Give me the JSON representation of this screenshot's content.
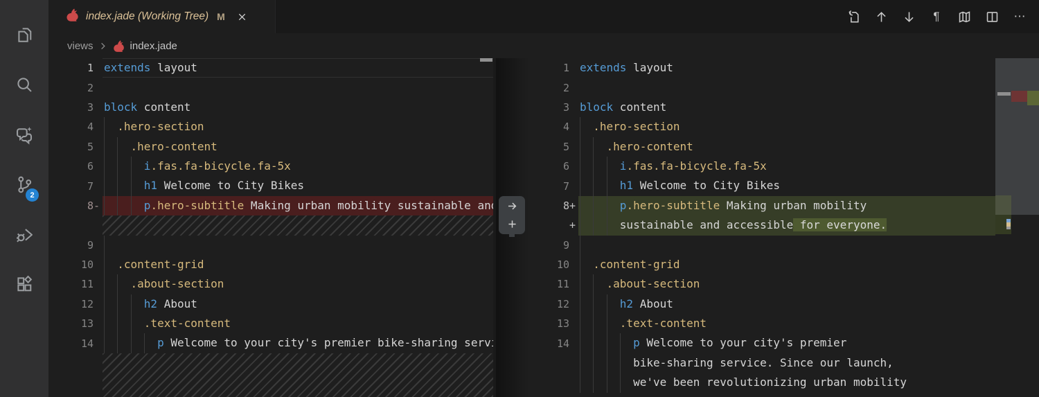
{
  "tab": {
    "title": "index.jade (Working Tree)",
    "status_badge": "M"
  },
  "breadcrumb": {
    "folder": "views",
    "file": "index.jade",
    "file_icon": "jade-rabbit-icon"
  },
  "toolbar": {
    "icons": [
      "revert-file",
      "previous-change",
      "next-change",
      "toggle-whitespace",
      "map",
      "split-editor",
      "more-actions"
    ],
    "pilcrow": "¶",
    "ellipsis": "⋯"
  },
  "activity_bar": {
    "items": [
      {
        "name": "explorer"
      },
      {
        "name": "search"
      },
      {
        "name": "copilot-chat"
      },
      {
        "name": "source-control",
        "badge": "2"
      },
      {
        "name": "run-and-debug"
      },
      {
        "name": "extensions"
      }
    ]
  },
  "colors": {
    "editor_bg": "#1e1e1e",
    "activity_bar_bg": "#303031",
    "badge_blue": "#2483d2",
    "removed_line_bg": "#4a1e1e",
    "added_line_bg": "#363d27",
    "inserted_char_bg": "#4e5a30",
    "keyword": "#569cd6",
    "class_literal": "#d7ba7d",
    "plain_text": "#d6d6d6",
    "line_number": "#858585",
    "modified_tab_label": "#dcc298"
  },
  "editors": {
    "left": {
      "side": "original",
      "rows": [
        {
          "n": "1",
          "kind": "current",
          "g": 0,
          "segs": [
            [
              "k",
              "extends"
            ],
            [
              "t",
              " layout"
            ]
          ]
        },
        {
          "n": "2",
          "kind": "blank",
          "g": 0,
          "segs": []
        },
        {
          "n": "3",
          "kind": "n",
          "g": 0,
          "segs": [
            [
              "k",
              "block"
            ],
            [
              "t",
              " content"
            ]
          ]
        },
        {
          "n": "4",
          "kind": "n",
          "g": 1,
          "segs": [
            [
              "t",
              "  "
            ],
            [
              "c",
              ".hero-section"
            ]
          ]
        },
        {
          "n": "5",
          "kind": "n",
          "g": 2,
          "segs": [
            [
              "t",
              "    "
            ],
            [
              "c",
              ".hero-content"
            ]
          ]
        },
        {
          "n": "6",
          "kind": "n",
          "g": 3,
          "segs": [
            [
              "t",
              "      "
            ],
            [
              "g",
              "i"
            ],
            [
              "c",
              ".fas.fa-bicycle.fa-5x"
            ]
          ]
        },
        {
          "n": "7",
          "kind": "n",
          "g": 3,
          "segs": [
            [
              "t",
              "      "
            ],
            [
              "g",
              "h1"
            ],
            [
              "t",
              " Welcome to City Bikes"
            ]
          ]
        },
        {
          "n": "8",
          "sign": "-",
          "kind": "removed",
          "g": 3,
          "segs": [
            [
              "t",
              "      "
            ],
            [
              "g",
              "p"
            ],
            [
              "c",
              ".hero-subtitle"
            ],
            [
              "t",
              " Making urban mobility sustainable and accessible for everyone."
            ]
          ]
        },
        {
          "kind": "hatch",
          "g": 0,
          "segs": []
        },
        {
          "n": "9",
          "kind": "blank",
          "g": 1,
          "segs": []
        },
        {
          "n": "10",
          "kind": "n",
          "g": 1,
          "segs": [
            [
              "t",
              "  "
            ],
            [
              "c",
              ".content-grid"
            ]
          ]
        },
        {
          "n": "11",
          "kind": "n",
          "g": 2,
          "segs": [
            [
              "t",
              "    "
            ],
            [
              "c",
              ".about-section"
            ]
          ]
        },
        {
          "n": "12",
          "kind": "n",
          "g": 3,
          "segs": [
            [
              "t",
              "      "
            ],
            [
              "g",
              "h2"
            ],
            [
              "t",
              " About"
            ]
          ]
        },
        {
          "n": "13",
          "kind": "n",
          "g": 3,
          "segs": [
            [
              "t",
              "      "
            ],
            [
              "c",
              ".text-content"
            ]
          ]
        },
        {
          "n": "14",
          "kind": "n",
          "g": 4,
          "segs": [
            [
              "t",
              "        "
            ],
            [
              "g",
              "p"
            ],
            [
              "t",
              " Welcome to your city's premier bike-sharing service. Since our launch, we've been revolutionizing urban mobility"
            ]
          ]
        },
        {
          "kind": "hatch",
          "tall": true,
          "g": 0,
          "segs": []
        }
      ]
    },
    "right": {
      "side": "modified",
      "rows": [
        {
          "n": "1",
          "kind": "n",
          "g": 0,
          "segs": [
            [
              "k",
              "extends"
            ],
            [
              "t",
              " layout"
            ]
          ]
        },
        {
          "n": "2",
          "kind": "blank",
          "g": 0,
          "segs": []
        },
        {
          "n": "3",
          "kind": "n",
          "g": 0,
          "segs": [
            [
              "k",
              "block"
            ],
            [
              "t",
              " content"
            ]
          ]
        },
        {
          "n": "4",
          "kind": "n",
          "g": 1,
          "segs": [
            [
              "t",
              "  "
            ],
            [
              "c",
              ".hero-section"
            ]
          ]
        },
        {
          "n": "5",
          "kind": "n",
          "g": 2,
          "segs": [
            [
              "t",
              "    "
            ],
            [
              "c",
              ".hero-content"
            ]
          ]
        },
        {
          "n": "6",
          "kind": "n",
          "g": 3,
          "segs": [
            [
              "t",
              "      "
            ],
            [
              "g",
              "i"
            ],
            [
              "c",
              ".fas.fa-bicycle.fa-5x"
            ]
          ]
        },
        {
          "n": "7",
          "kind": "n",
          "g": 3,
          "segs": [
            [
              "t",
              "      "
            ],
            [
              "g",
              "h1"
            ],
            [
              "t",
              " Welcome to City Bikes"
            ]
          ]
        },
        {
          "n": "8",
          "sign": "+",
          "kind": "added",
          "g": 3,
          "segs": [
            [
              "t",
              "      "
            ],
            [
              "g",
              "p"
            ],
            [
              "c",
              ".hero-subtitle"
            ],
            [
              "t",
              " Making urban mobility"
            ]
          ]
        },
        {
          "sign": "+",
          "kind": "added",
          "g": 3,
          "segs": [
            [
              "t",
              "      "
            ],
            [
              "t",
              "sustainable and accessible"
            ],
            [
              "i",
              " for everyone."
            ]
          ]
        },
        {
          "n": "9",
          "kind": "blank",
          "g": 1,
          "segs": []
        },
        {
          "n": "10",
          "kind": "n",
          "g": 1,
          "segs": [
            [
              "t",
              "  "
            ],
            [
              "c",
              ".content-grid"
            ]
          ]
        },
        {
          "n": "11",
          "kind": "n",
          "g": 2,
          "segs": [
            [
              "t",
              "    "
            ],
            [
              "c",
              ".about-section"
            ]
          ]
        },
        {
          "n": "12",
          "kind": "n",
          "g": 3,
          "segs": [
            [
              "t",
              "      "
            ],
            [
              "g",
              "h2"
            ],
            [
              "t",
              " About"
            ]
          ]
        },
        {
          "n": "13",
          "kind": "n",
          "g": 3,
          "segs": [
            [
              "t",
              "      "
            ],
            [
              "c",
              ".text-content"
            ]
          ]
        },
        {
          "n": "14",
          "kind": "n",
          "g": 4,
          "segs": [
            [
              "t",
              "        "
            ],
            [
              "g",
              "p"
            ],
            [
              "t",
              " Welcome to your city's premier"
            ]
          ]
        },
        {
          "kind": "n",
          "g": 4,
          "segs": [
            [
              "t",
              "        "
            ],
            [
              "t",
              "bike-sharing service. Since our launch,"
            ]
          ]
        },
        {
          "kind": "n",
          "g": 4,
          "segs": [
            [
              "t",
              "        "
            ],
            [
              "t",
              "we've been revolutionizing urban mobility"
            ]
          ]
        }
      ]
    }
  }
}
